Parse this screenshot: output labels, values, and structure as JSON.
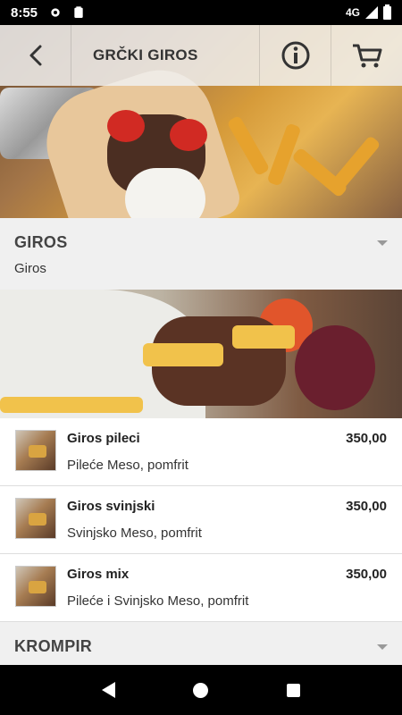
{
  "status_bar": {
    "time": "8:55",
    "network": "4G",
    "icons": [
      "gear-icon",
      "clipboard-icon",
      "signal-icon",
      "battery-icon"
    ]
  },
  "app_bar": {
    "title": "GRČKI GIROS",
    "icons": [
      "back-arrow-icon",
      "info-icon",
      "cart-icon"
    ]
  },
  "categories": [
    {
      "title": "GIROS",
      "description": "Giros"
    },
    {
      "title": "KROMPIR",
      "description": ""
    }
  ],
  "items": [
    {
      "name": "Giros pileci",
      "description": "Pileće Meso, pomfrit",
      "price": "350,00"
    },
    {
      "name": "Giros svinjski",
      "description": "Svinjsko Meso, pomfrit",
      "price": "350,00"
    },
    {
      "name": "Giros mix",
      "description": "Pileće i Svinjsko Meso, pomfrit",
      "price": "350,00"
    }
  ],
  "colors": {
    "app_bar_bg": "#f0f0f0",
    "category_bg": "#f0f0f0",
    "text_primary": "#222222"
  },
  "nav_bar": {
    "icons": [
      "nav-back-icon",
      "nav-home-icon",
      "nav-recent-icon"
    ]
  }
}
